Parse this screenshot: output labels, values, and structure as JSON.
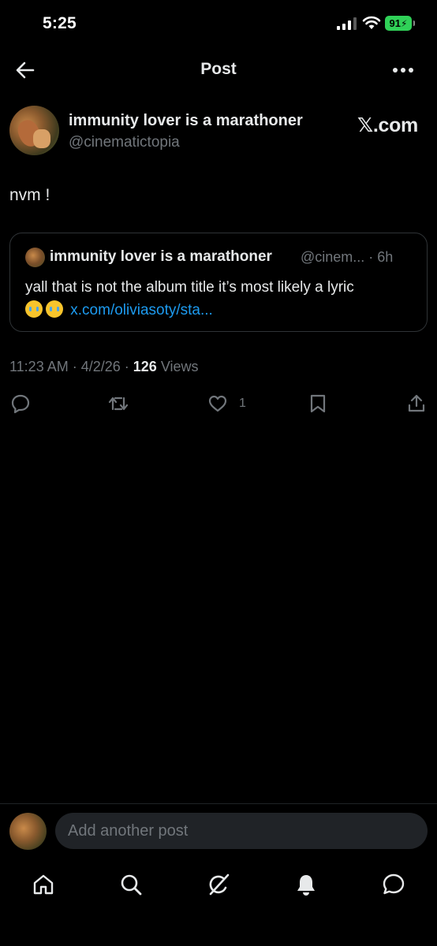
{
  "status_bar": {
    "time": "5:25",
    "battery": "91"
  },
  "nav": {
    "title": "Post"
  },
  "author": {
    "display_name": "immunity lover is a marathoner",
    "handle": "@cinematictopia",
    "watermark": "𝕏.com"
  },
  "post": {
    "text": "nvm !"
  },
  "quote": {
    "display_name": "immunity lover is a marathoner",
    "meta": "@cinem... · 6h",
    "text": "yall that is not the album title it’s most likely a lyric",
    "link": "x.com/oliviasoty/sta..."
  },
  "meta": {
    "time": "11:23 AM",
    "date": "4/2/26",
    "views_count": "126",
    "views_label": "Views"
  },
  "actions": {
    "like_count": "1"
  },
  "reply": {
    "placeholder": "Add another post"
  },
  "icons": {
    "back": "arrow-left-icon",
    "more": "more-horizontal-icon",
    "reply": "comment-icon",
    "repost": "repost-icon",
    "like": "heart-icon",
    "bookmark": "bookmark-icon",
    "share": "share-icon",
    "home": "home-icon",
    "search": "search-icon",
    "grok": "grok-icon",
    "notifications": "bell-icon",
    "messages": "message-icon"
  },
  "colors": {
    "background": "#000000",
    "text": "#e7e9ea",
    "muted": "#71767b",
    "link": "#1d9bf0",
    "battery": "#30d158"
  }
}
